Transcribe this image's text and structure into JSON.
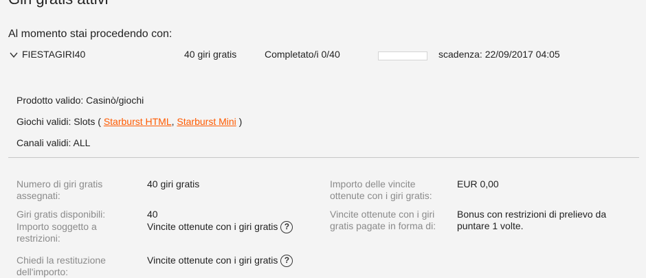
{
  "page": {
    "title": "Giri gratis attivi",
    "subtitle": "Al momento stai procedendo con:"
  },
  "bonus": {
    "code": "FIESTAGIRI40",
    "spins": "40 giri gratis",
    "completed": "Completato/i 0/40",
    "progress_fraction": 0,
    "expiry": "scadenza: 22/09/2017 04:05"
  },
  "details": {
    "product_label": "Prodotto valido: Casinò/giochi",
    "games_prefix": "Giochi validi: Slots (",
    "game_links": [
      "Starburst HTML",
      "Starburst Mini"
    ],
    "games_separator": ",",
    "games_suffix": ")",
    "channels_label": "Canali validi: ALL"
  },
  "info": {
    "assigned_label": "Numero di giri gratis assegnati:",
    "assigned_value": "40 giri gratis",
    "available_label": "Giri gratis disponibili:",
    "available_value": "40",
    "restricted_label": "Importo soggetto a restrizioni:",
    "restricted_value": "Vincite ottenute con i giri gratis",
    "refund_label": "Chiedi la restituzione dell'importo:",
    "refund_value": "Vincite ottenute con i giri gratis",
    "winnings_label": "Importo delle vincite ottenute con i giri gratis:",
    "winnings_value": "EUR 0,00",
    "paid_label": "Vincite ottenute con i giri gratis pagate in forma di:",
    "paid_value": "Bonus con restrizioni di prelievo da puntare 1 volte.",
    "help_glyph": "?"
  },
  "colors": {
    "link": "#ff5a00",
    "label": "#8a8a8a",
    "background": "#f4f4f4"
  },
  "icons": {
    "expand": "chevron-down-icon",
    "help": "help-icon"
  }
}
